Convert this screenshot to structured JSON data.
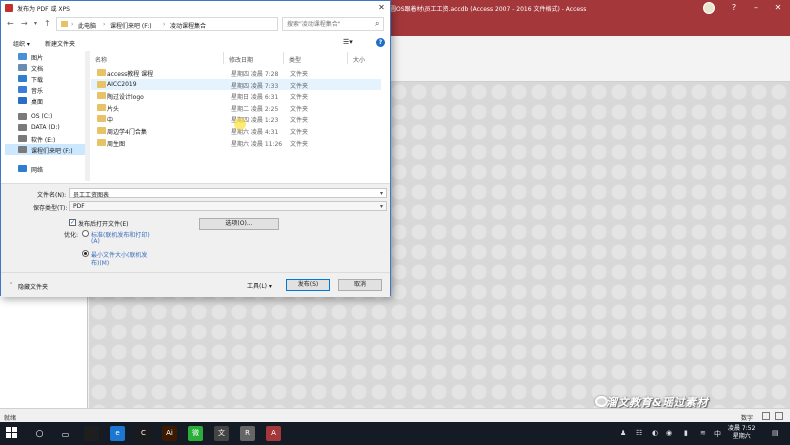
{
  "access": {
    "title": "圆OS跟着材\\员工工资.accdb (Access 2007 - 2016 文件格式) - Access",
    "status_left": "就绪",
    "status_right": "数字",
    "watermark": "溜文教育&瑶过素材"
  },
  "dialog": {
    "title": "发布为 PDF 或 XPS",
    "close": "✕",
    "breadcrumb": [
      "此电脑",
      "课程们来吧 (F:)",
      "凌动课程集合"
    ],
    "search_placeholder": "搜索\"凌动课程集合\"",
    "toolbar": {
      "organize": "组织 ▾",
      "new_folder": "新建文件夹",
      "help": "?"
    },
    "tree": [
      {
        "label": "图片",
        "icon_color": "#4a90d9",
        "selected": false
      },
      {
        "label": "文档",
        "icon_color": "#6a8caf",
        "selected": false
      },
      {
        "label": "下载",
        "icon_color": "#2f7fd0",
        "selected": false
      },
      {
        "label": "音乐",
        "icon_color": "#3b7dd8",
        "selected": false
      },
      {
        "label": "桌面",
        "icon_color": "#2b6cc4",
        "selected": false
      },
      {
        "label": "OS (C:)",
        "icon_color": "#7a7a7a",
        "selected": false
      },
      {
        "label": "DATA (D:)",
        "icon_color": "#7a7a7a",
        "selected": false
      },
      {
        "label": "软件 (E:)",
        "icon_color": "#7a7a7a",
        "selected": false
      },
      {
        "label": "课程们来吧 (F:)",
        "icon_color": "#7a7a7a",
        "selected": true
      },
      {
        "label": "网络",
        "icon_color": "#2f7fd0",
        "selected": false
      }
    ],
    "columns": {
      "name": "名称",
      "modified": "修改日期",
      "type": "类型",
      "size": "大小"
    },
    "files": [
      {
        "name": "access教程 课程",
        "date": "星期四 凌晨 7:28",
        "type": "文件夹"
      },
      {
        "name": "AICC2019",
        "date": "星期四 凌晨 7:33",
        "type": "文件夹"
      },
      {
        "name": "陶过设计logo",
        "date": "星期日 凌晨 6:31",
        "type": "文件夹"
      },
      {
        "name": "片头",
        "date": "星期二 凌晨 2:25",
        "type": "文件夹"
      },
      {
        "name": "中",
        "date": "星期四 凌晨 1:23",
        "type": "文件夹"
      },
      {
        "name": "周边学4门合集",
        "date": "星期六 凌晨 4:31",
        "type": "文件夹"
      },
      {
        "name": "周生图",
        "date": "星期六 凌晨 11:26",
        "type": "文件夹"
      }
    ],
    "filename_label": "文件名(N):",
    "filename_value": "员工工资图表",
    "savetype_label": "保存类型(T):",
    "savetype_value": "PDF",
    "open_after_label": "发布后打开文件(E)",
    "optimize_label": "优化:",
    "opt_standard": "标准(联机发布和打印)",
    "opt_standard_2": "(A)",
    "opt_min": "最小文件大小(联机发",
    "opt_min_2": "布)(M)",
    "options_button": "选项(O)...",
    "hide_folders": "隐藏文件夹",
    "tools": "工具(L) ▾",
    "publish": "发布(S)",
    "cancel": "取消"
  },
  "taskbar": {
    "time": "凌晨 7:52",
    "day": "星期六",
    "apps": [
      {
        "label": "",
        "color": "#1e1e1e"
      },
      {
        "label": "e",
        "color": "#1b77d2"
      },
      {
        "label": "C",
        "color": "#1a1a1a"
      },
      {
        "label": "Ai",
        "color": "#3c1a00"
      },
      {
        "label": "微",
        "color": "#2aae3a"
      },
      {
        "label": "文",
        "color": "#444"
      },
      {
        "label": "R",
        "color": "#666"
      },
      {
        "label": "A",
        "color": "#a4373a"
      }
    ]
  }
}
